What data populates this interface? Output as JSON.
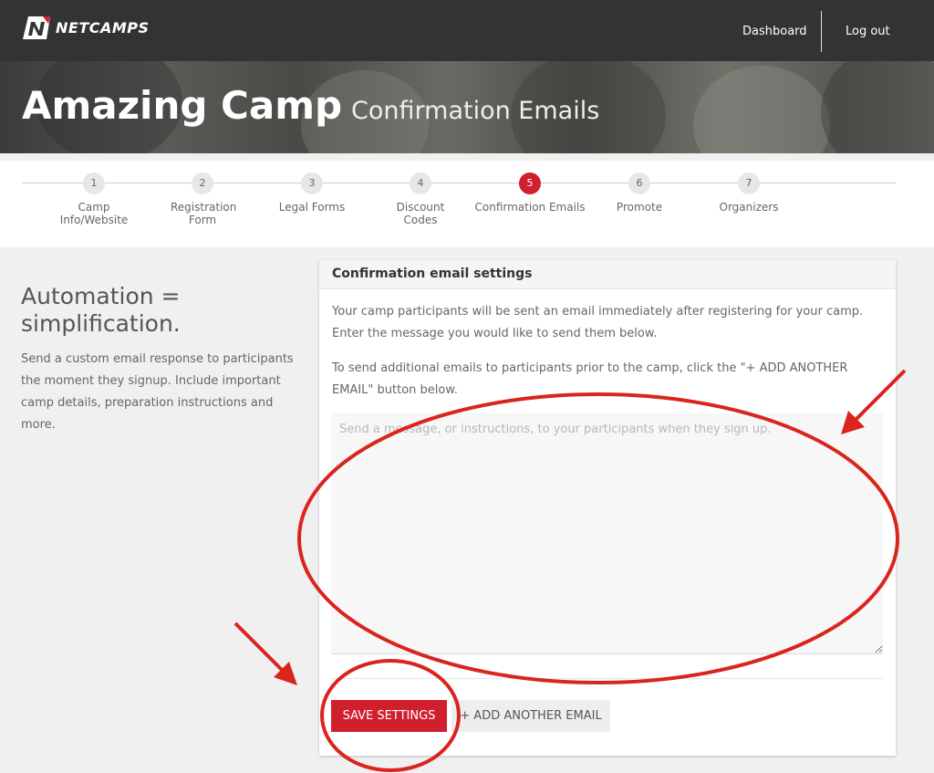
{
  "header": {
    "brand": "NETCAMPS",
    "nav": {
      "dashboard": "Dashboard",
      "logout": "Log out"
    }
  },
  "hero": {
    "title": "Amazing Camp",
    "subtitle": "Confirmation Emails"
  },
  "steps": [
    {
      "number": "1",
      "label": "Camp Info/Website"
    },
    {
      "number": "2",
      "label": "Registration Form"
    },
    {
      "number": "3",
      "label": "Legal Forms"
    },
    {
      "number": "4",
      "label": "Discount Codes"
    },
    {
      "number": "5",
      "label": "Confirmation Emails",
      "active": true
    },
    {
      "number": "6",
      "label": "Promote"
    },
    {
      "number": "7",
      "label": "Organizers"
    }
  ],
  "sidebar": {
    "title": "Automation = simplification.",
    "description": "Send a custom email response to participants the moment they signup. Include important camp details, preparation instructions and more."
  },
  "card": {
    "title": "Confirmation email settings",
    "paragraph1": "Your camp participants will be sent an email immediately after registering for your camp. Enter the message you would like to send them below.",
    "paragraph2": "To send additional emails to participants prior to the camp, click the \"+ ADD ANOTHER EMAIL\" button below.",
    "message_placeholder": "Send a message, or instructions, to your participants when they sign up.",
    "message_value": "",
    "save_label": "SAVE SETTINGS",
    "add_label": "+ ADD ANOTHER EMAIL"
  },
  "colors": {
    "topbar": "#333333",
    "accent": "#d0202e",
    "page_bg": "#f0f0f0",
    "annotation": "#d9251d"
  },
  "icons": {
    "logo": "netcamps-logo-icon"
  }
}
